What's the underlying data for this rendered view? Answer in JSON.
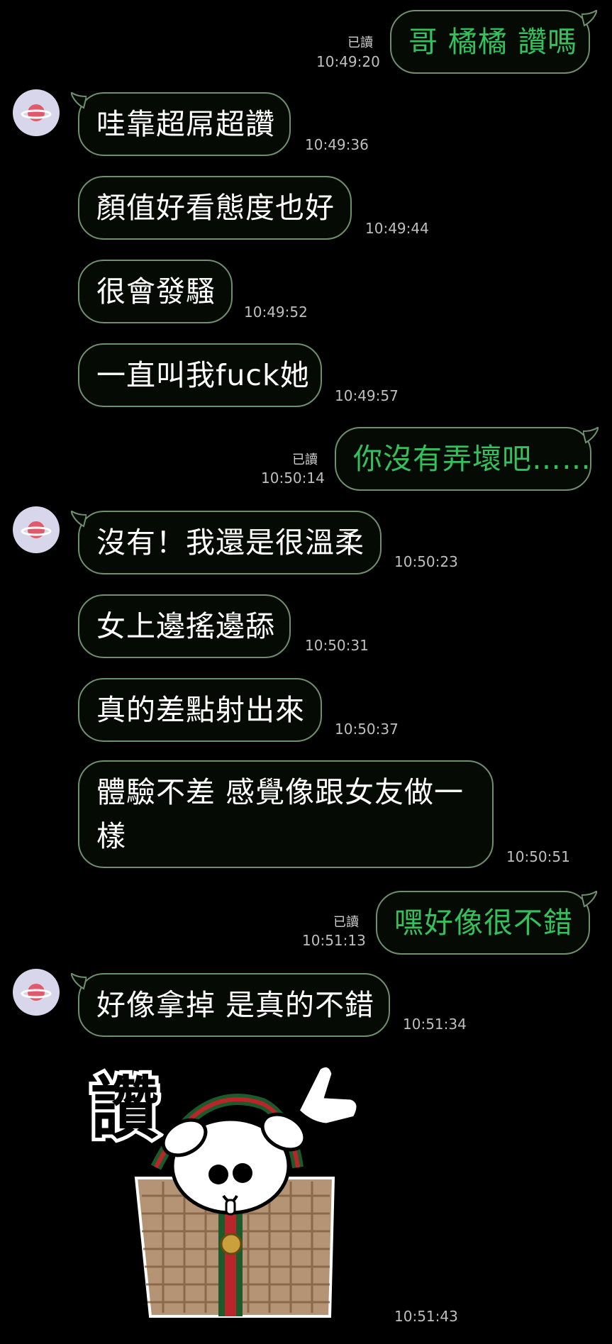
{
  "messages": [
    {
      "id": "m1",
      "dir": "out",
      "text": "哥 橘橘 讚嗎",
      "read": "已讀",
      "time": "10:49:20"
    },
    {
      "id": "m2",
      "dir": "in",
      "text": "哇靠超屌超讚",
      "time": "10:49:36"
    },
    {
      "id": "m3",
      "dir": "in",
      "text": "顏值好看態度也好",
      "time": "10:49:44"
    },
    {
      "id": "m4",
      "dir": "in",
      "text": "很會發騷",
      "time": "10:49:52"
    },
    {
      "id": "m5",
      "dir": "in",
      "text": "一直叫我fuck她",
      "time": "10:49:57"
    },
    {
      "id": "m6",
      "dir": "out",
      "text": "你沒有弄壞吧……",
      "read": "已讀",
      "time": "10:50:14"
    },
    {
      "id": "m7",
      "dir": "in",
      "text": "沒有！我還是很溫柔",
      "time": "10:50:23"
    },
    {
      "id": "m8",
      "dir": "in",
      "text": "女上邊搖邊舔",
      "time": "10:50:31"
    },
    {
      "id": "m9",
      "dir": "in",
      "text": "真的差點射出來",
      "time": "10:50:37"
    },
    {
      "id": "m10",
      "dir": "in",
      "text_line1": "體驗不差 感覺像跟女友做一",
      "text_line2": "樣",
      "time": "10:50:51"
    },
    {
      "id": "m11",
      "dir": "out",
      "text": "嘿好像很不錯",
      "read": "已讀",
      "time": "10:51:13"
    },
    {
      "id": "m12",
      "dir": "in",
      "text": "好像拿掉 是真的不錯",
      "time": "10:51:34"
    }
  ],
  "sticker": {
    "caption": "讚",
    "icon": "thumbs-up-dog-sticker",
    "time": "10:51:43"
  },
  "colors": {
    "outgoing_text": "#34c05a",
    "incoming_text": "#ffffff",
    "bubble_border": "#6f8f6f",
    "avatar_bg": "#d7d6ea",
    "planet": "#e05a6a"
  }
}
